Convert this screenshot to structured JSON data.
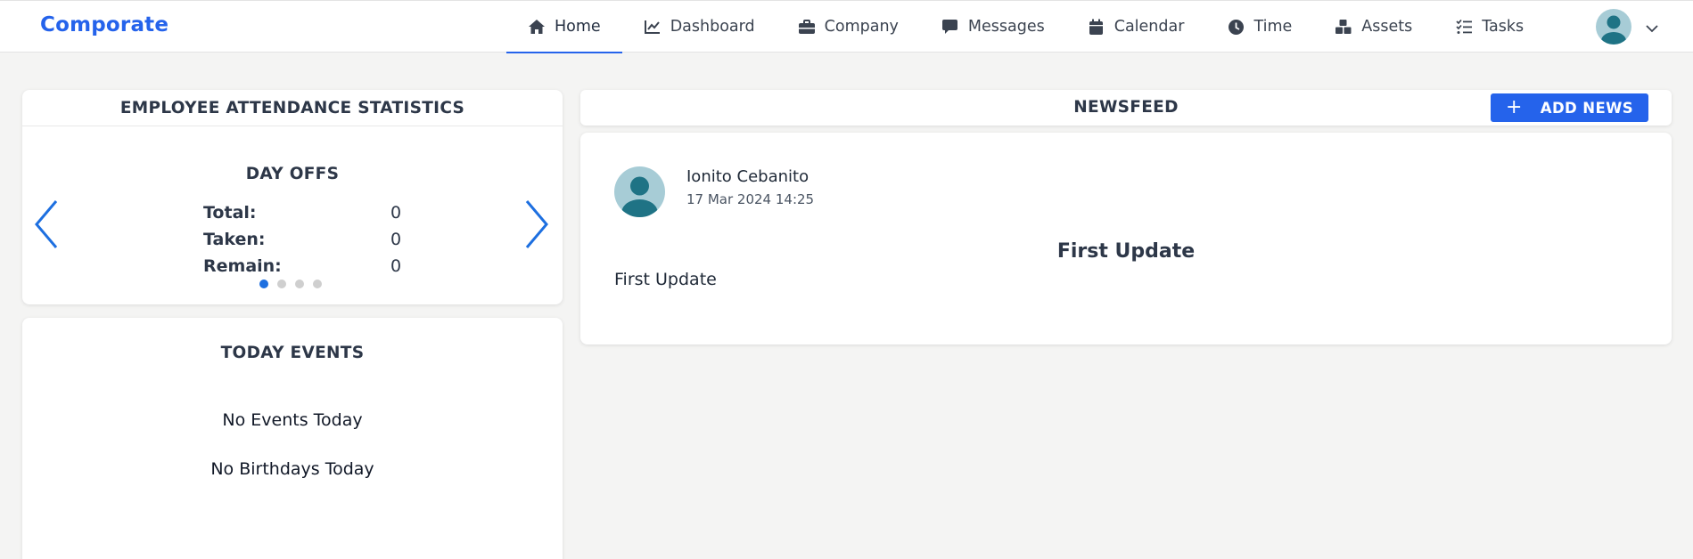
{
  "brand": "Comporate",
  "nav": {
    "items": [
      {
        "label": "Home",
        "icon": "home-icon"
      },
      {
        "label": "Dashboard",
        "icon": "chart-line-icon"
      },
      {
        "label": "Company",
        "icon": "briefcase-icon"
      },
      {
        "label": "Messages",
        "icon": "message-icon"
      },
      {
        "label": "Calendar",
        "icon": "calendar-icon"
      },
      {
        "label": "Time",
        "icon": "clock-icon"
      },
      {
        "label": "Assets",
        "icon": "boxes-icon"
      },
      {
        "label": "Tasks",
        "icon": "tasks-icon"
      }
    ],
    "active": "Home"
  },
  "attendance": {
    "title": "EMPLOYEE ATTENDANCE STATISTICS",
    "slide_title": "DAY OFFS",
    "rows": [
      {
        "label": "Total:",
        "value": "0"
      },
      {
        "label": "Taken:",
        "value": "0"
      },
      {
        "label": "Remain:",
        "value": "0"
      }
    ],
    "slides": 4,
    "active_slide": 1
  },
  "events": {
    "title": "TODAY EVENTS",
    "events_text": "No Events Today",
    "birthdays_text": "No Birthdays Today"
  },
  "newsfeed": {
    "title": "NEWSFEED",
    "add_label": "ADD NEWS",
    "post": {
      "author": "Ionito Cebanito",
      "date": "17 Mar 2024 14:25",
      "title": "First Update",
      "body": "First Update"
    }
  },
  "colors": {
    "accent": "#2563eb",
    "background": "#f4f4f3",
    "avatar_bg": "#a7ccd6",
    "avatar_fg": "#1f7385"
  }
}
